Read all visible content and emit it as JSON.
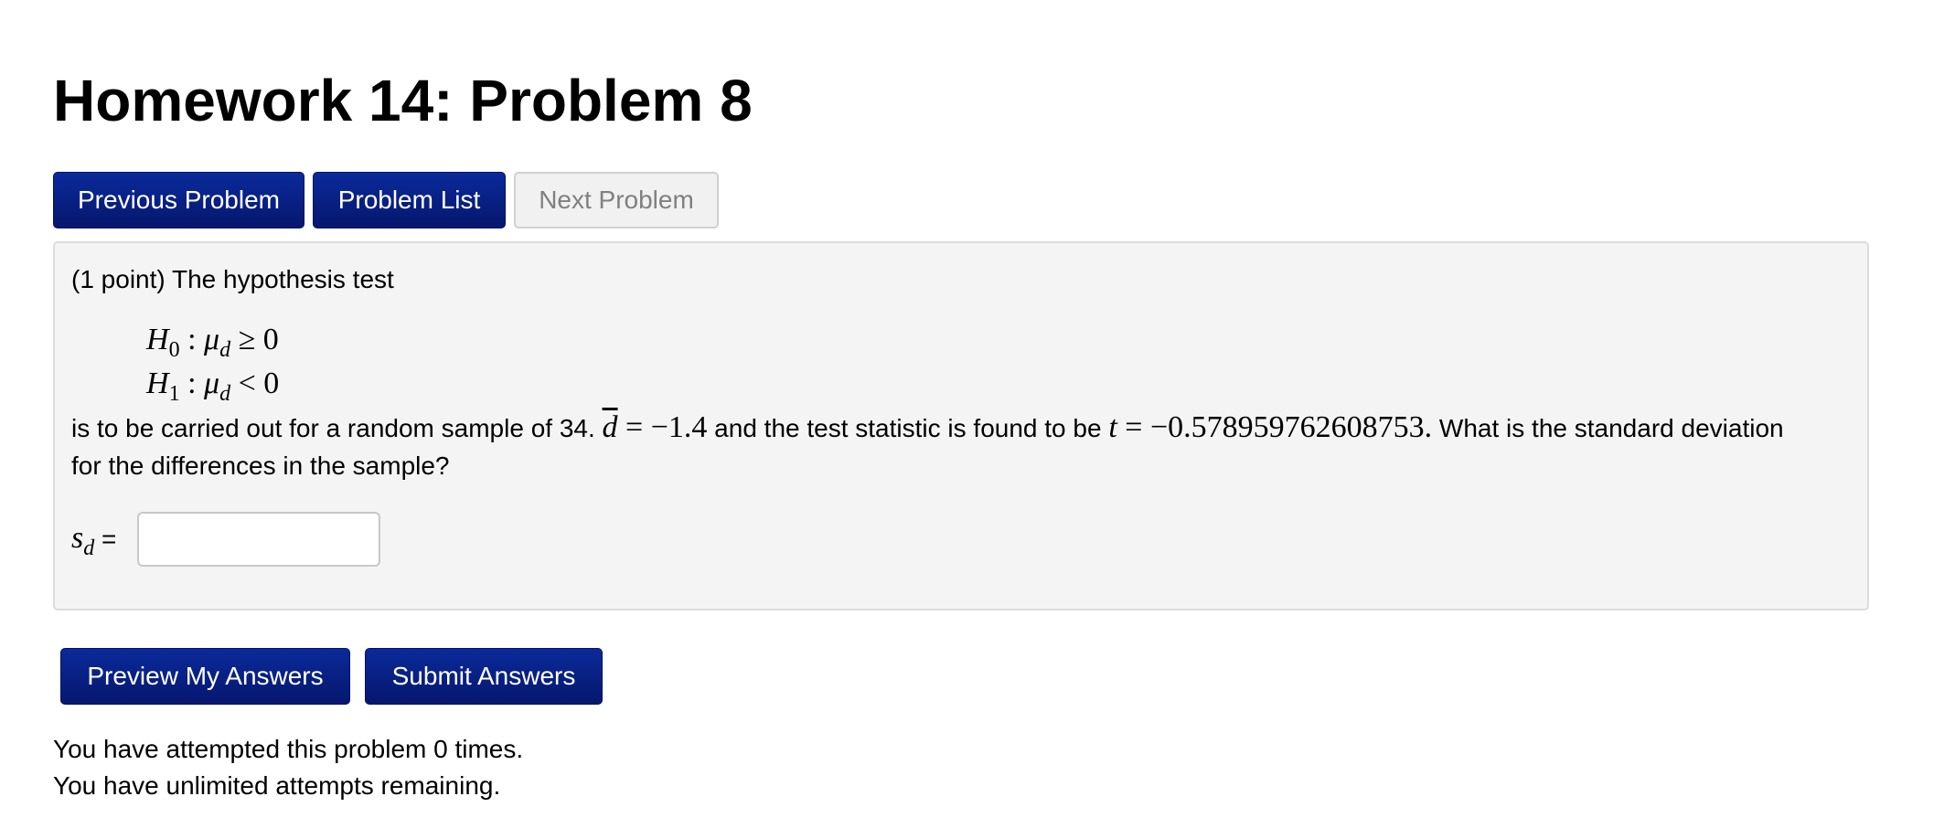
{
  "page": {
    "title": "Homework 14: Problem 8"
  },
  "nav": {
    "previous_label": "Previous Problem",
    "list_label": "Problem List",
    "next_label": "Next Problem"
  },
  "problem": {
    "intro": "(1 point) The hypothesis test",
    "h0_label": "H",
    "h0_sub": "0",
    "h0_rest_mu": "μ",
    "h0_rest_sub": "d",
    "h0_relation": " ≥ 0",
    "h1_label": "H",
    "h1_sub": "1",
    "h1_rest_mu": "μ",
    "h1_rest_sub": "d",
    "h1_relation": " < 0",
    "colon": " : ",
    "text_a": "is to be carried out for a random sample of 34.",
    "dbar_symbol": "d",
    "dbar_value": " = −1.4",
    "text_b": "and the test statistic is found to be",
    "t_symbol": "t",
    "t_value": " = −0.578959762608753.",
    "text_c": "What is the standard deviation",
    "text_d": "for the differences in the sample?",
    "sd_symbol": "s",
    "sd_sub": "d",
    "sd_equals": " =",
    "answer_value": "",
    "answer_placeholder": ""
  },
  "actions": {
    "preview_label": "Preview My Answers",
    "submit_label": "Submit Answers"
  },
  "status": {
    "attempts": "You have attempted this problem 0 times.",
    "remaining": "You have unlimited attempts remaining."
  },
  "colors": {
    "button_primary": "#06176e",
    "button_disabled_bg": "#f1f1f1",
    "panel_bg": "#f4f4f4"
  }
}
